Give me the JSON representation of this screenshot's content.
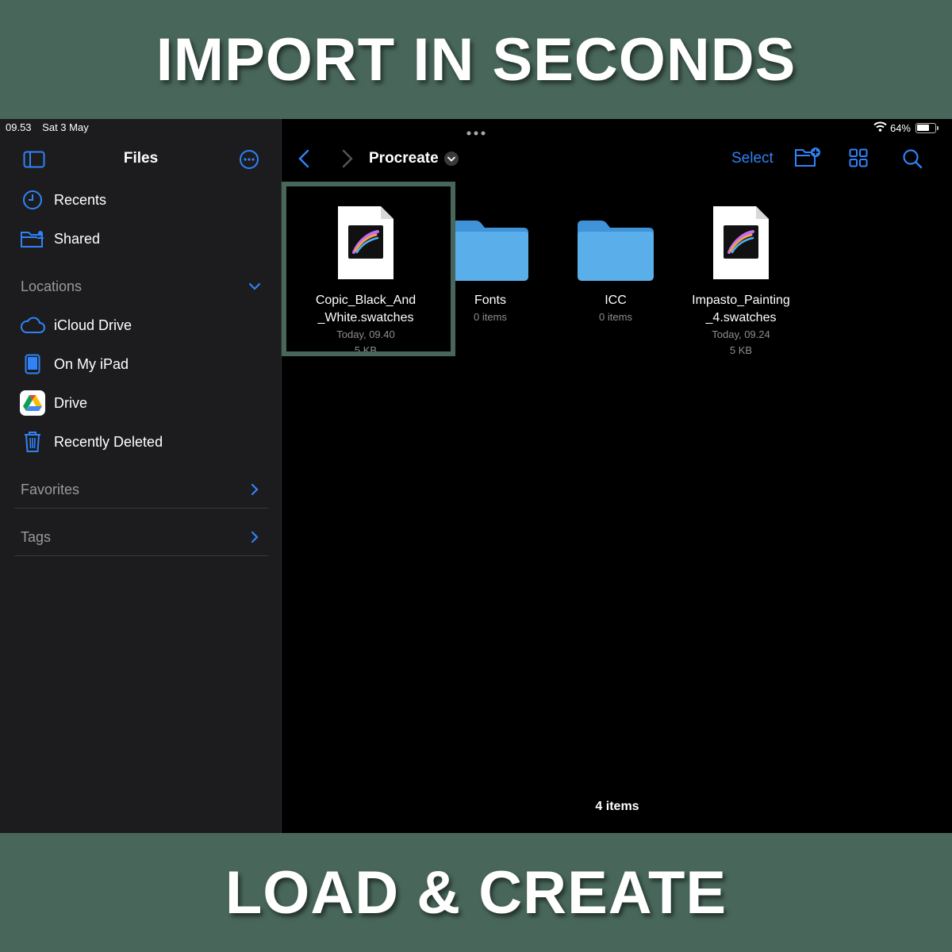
{
  "banners": {
    "top": "IMPORT IN SECONDS",
    "bottom": "LOAD & CREATE"
  },
  "status": {
    "time": "09.53",
    "date": "Sat 3 May",
    "battery": "64%"
  },
  "sidebar": {
    "title": "Files",
    "items": [
      {
        "label": "Recents",
        "icon": "clock-icon"
      },
      {
        "label": "Shared",
        "icon": "shared-folder-icon"
      }
    ],
    "locations": {
      "heading": "Locations",
      "items": [
        {
          "label": "iCloud Drive",
          "icon": "cloud-icon"
        },
        {
          "label": "On My iPad",
          "icon": "ipad-icon"
        },
        {
          "label": "Drive",
          "icon": "google-drive-icon"
        },
        {
          "label": "Recently Deleted",
          "icon": "trash-icon"
        }
      ]
    },
    "favorites": "Favorites",
    "tags": "Tags"
  },
  "toolbar": {
    "title": "Procreate",
    "select": "Select"
  },
  "files": [
    {
      "name1": "Copic_Black_And",
      "name2": "_White.swatches",
      "date": "Today, 09.40",
      "size": "5 KB",
      "kind": "procreate-file"
    },
    {
      "name1": "Fonts",
      "info": "0 items",
      "kind": "folder"
    },
    {
      "name1": "ICC",
      "info": "0 items",
      "kind": "folder"
    },
    {
      "name1": "Impasto_Painting",
      "name2": "_4.swatches",
      "date": "Today, 09.24",
      "size": "5 KB",
      "kind": "procreate-file"
    }
  ],
  "footer": {
    "count": "4 items"
  },
  "colors": {
    "accent": "#2f83f7",
    "banner": "#48675a",
    "sidebar": "#1c1c1e",
    "folder": "#5aaee9"
  }
}
